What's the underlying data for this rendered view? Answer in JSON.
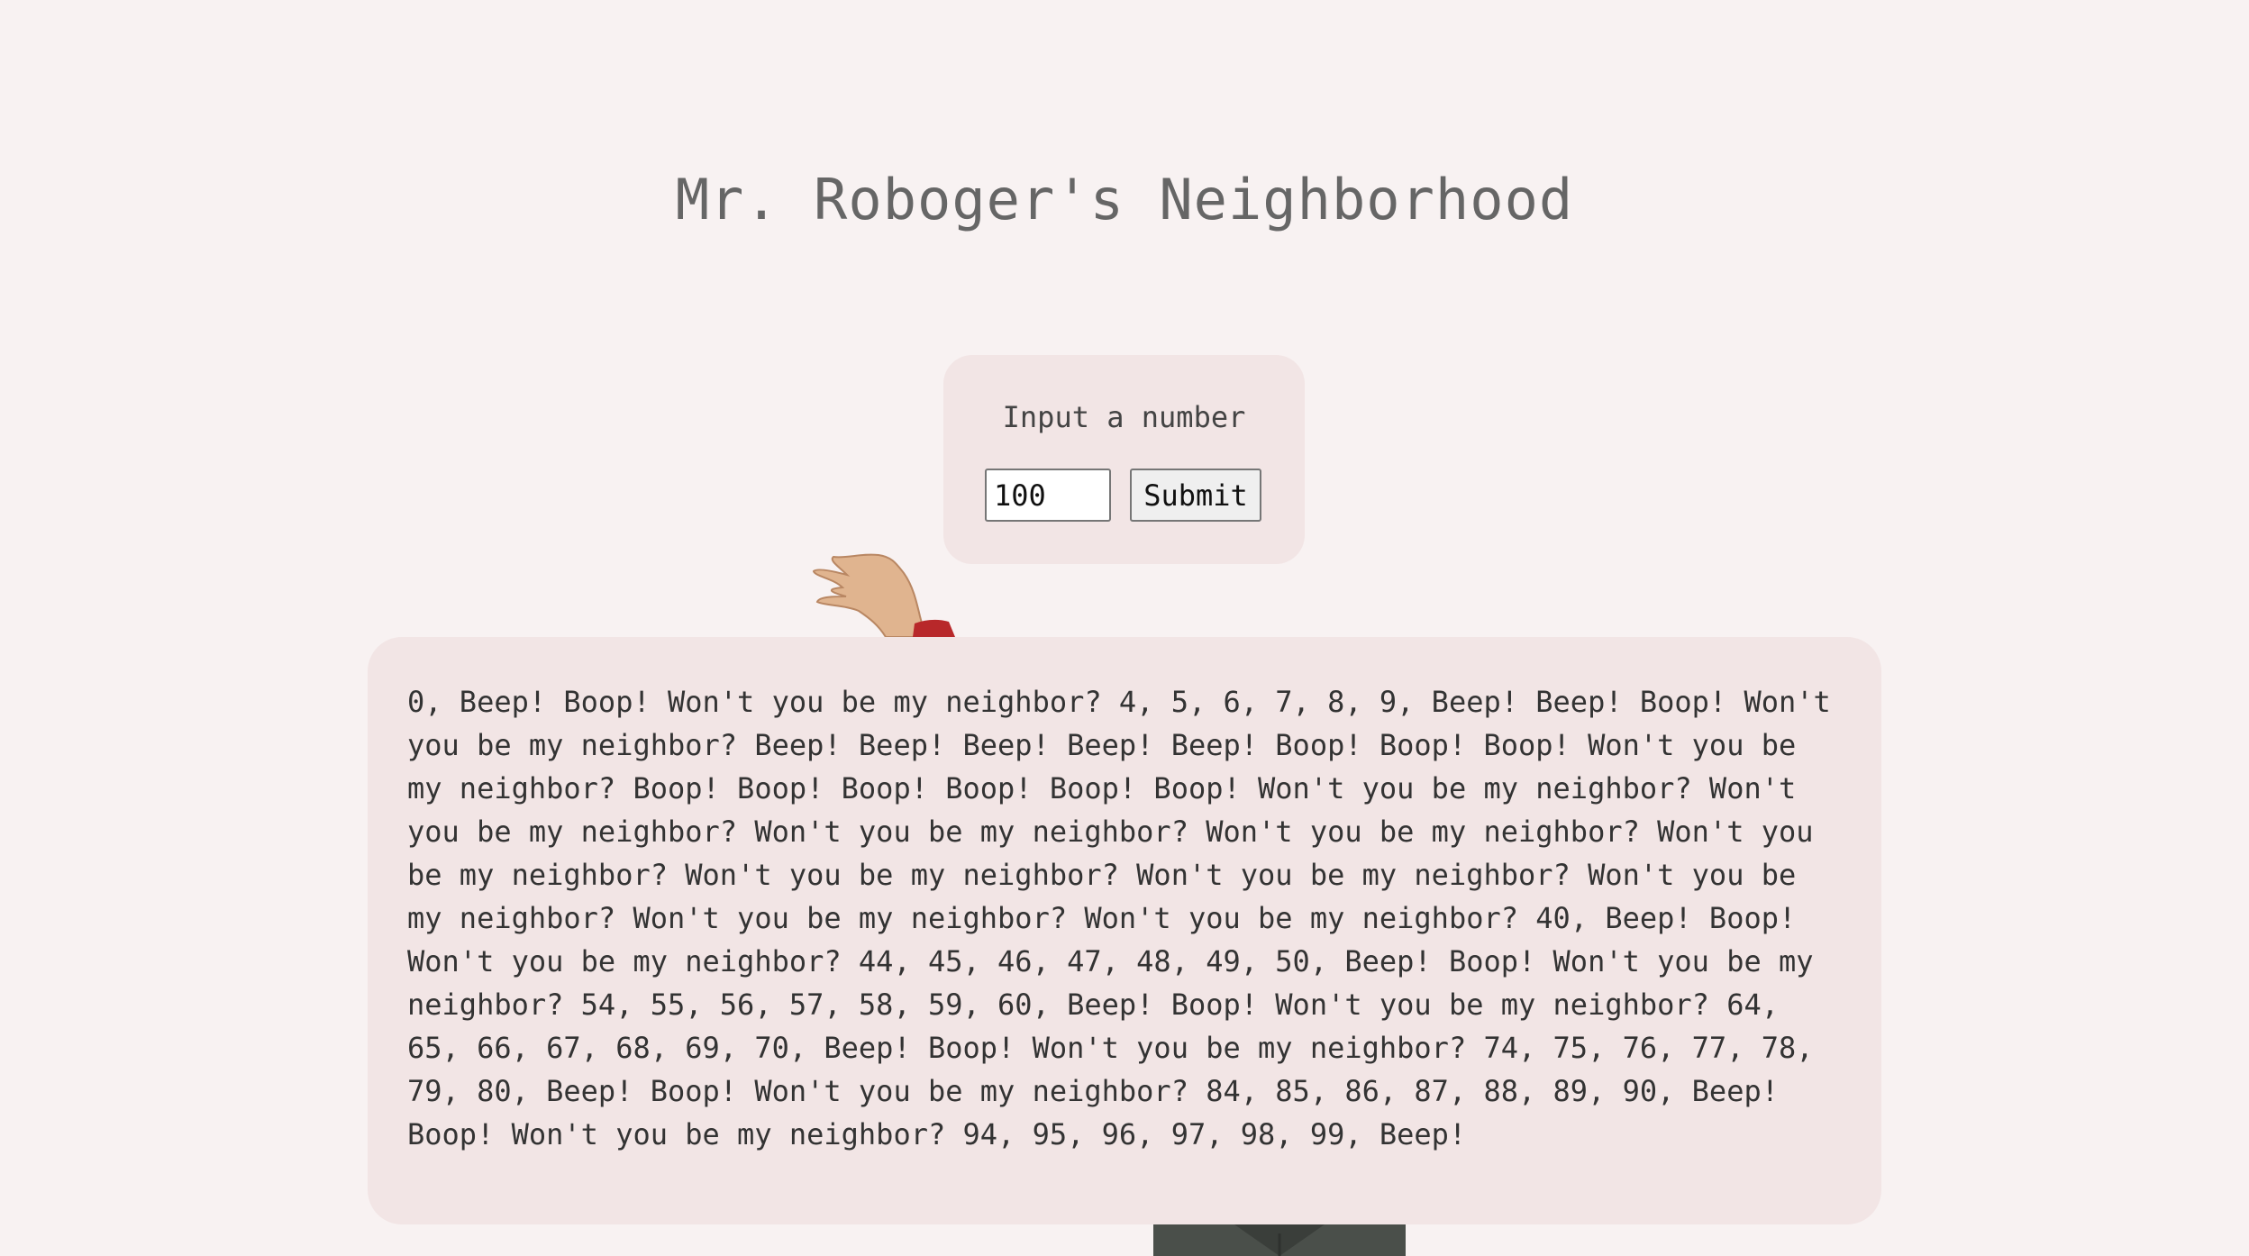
{
  "page": {
    "title": "Mr. Roboger's Neighborhood"
  },
  "form": {
    "label": "Input a number",
    "input_value": "100",
    "submit_label": "Submit"
  },
  "result": {
    "text": "0, Beep! Boop! Won't you be my neighbor? 4, 5, 6, 7, 8, 9, Beep! Beep! Boop! Won't you be my neighbor? Beep! Beep! Beep! Beep! Beep! Boop! Boop! Boop! Won't you be my neighbor? Boop! Boop! Boop! Boop! Boop! Boop! Won't you be my neighbor? Won't you be my neighbor? Won't you be my neighbor? Won't you be my neighbor? Won't you be my neighbor? Won't you be my neighbor? Won't you be my neighbor? Won't you be my neighbor? Won't you be my neighbor? Won't you be my neighbor? 40, Beep! Boop! Won't you be my neighbor? 44, 45, 46, 47, 48, 49, 50, Beep! Boop! Won't you be my neighbor? 54, 55, 56, 57, 58, 59, 60, Beep! Boop! Won't you be my neighbor? 64, 65, 66, 67, 68, 69, 70, Beep! Boop! Won't you be my neighbor? 74, 75, 76, 77, 78, 79, 80, Beep! Boop! Won't you be my neighbor? 84, 85, 86, 87, 88, 89, 90, Beep! Boop! Won't you be my neighbor? 94, 95, 96, 97, 98, 99, Beep!"
  },
  "colors": {
    "background": "#f8f2f2",
    "card": "#f2e5e5",
    "title": "#666666",
    "text": "#333333"
  }
}
